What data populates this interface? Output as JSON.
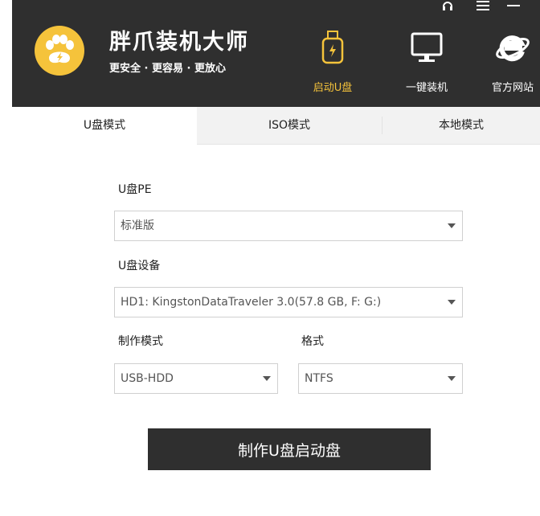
{
  "header": {
    "title": "胖爪装机大师",
    "slogan": "更安全 · 更容易 · 更放心",
    "nav": [
      {
        "label": "启动U盘",
        "icon": "usb-icon",
        "active": true
      },
      {
        "label": "一键装机",
        "icon": "monitor-icon",
        "active": false
      },
      {
        "label": "官方网站",
        "icon": "ie-browser-icon",
        "active": false
      }
    ],
    "window_controls": [
      "support-icon",
      "menu-icon",
      "minimize-icon"
    ]
  },
  "tabs": [
    {
      "label": "U盘模式",
      "active": true
    },
    {
      "label": "ISO模式",
      "active": false
    },
    {
      "label": "本地模式",
      "active": false
    }
  ],
  "form": {
    "pe_label": "U盘PE",
    "pe_value": "标准版",
    "device_label": "U盘设备",
    "device_value": "HD1: KingstonDataTraveler 3.0(57.8 GB, F: G:)",
    "mode_label": "制作模式",
    "mode_value": "USB-HDD",
    "format_label": "格式",
    "format_value": "NTFS"
  },
  "action_button": "制作U盘启动盘",
  "colors": {
    "header_bg": "#2f2f2f",
    "accent": "#f5c33b",
    "tab_bg": "#f2f2f2"
  }
}
